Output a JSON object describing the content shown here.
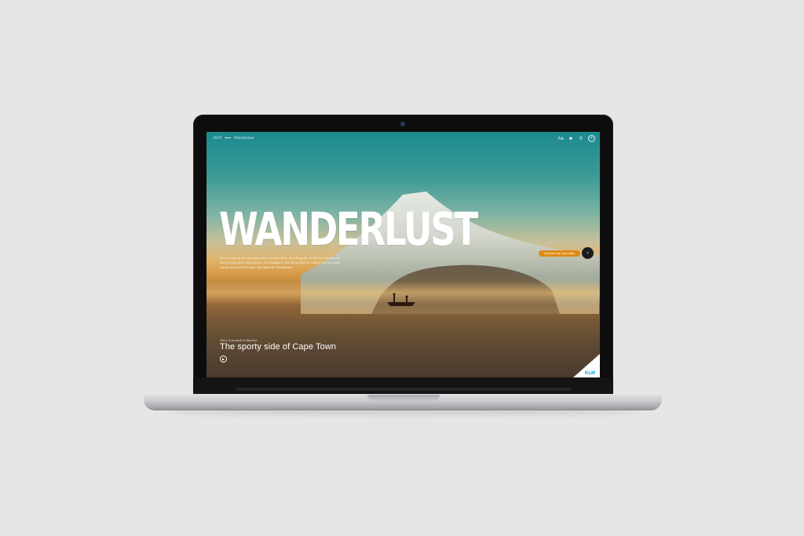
{
  "header": {
    "brand": "1919",
    "section": "Wanderlust"
  },
  "nav_icons": [
    "font-size-icon",
    "user-icon",
    "search-icon",
    "menu-circle-icon"
  ],
  "hero": {
    "headline": "WANDERLUST",
    "intro": "For as long as we can remember, we have been travelling the world and sharing our most memorable experiences. We thought it was about time to collate our favourite stories and put them into one inherent 'Wanderlust'.",
    "cta_label": "Discover our favourites"
  },
  "story": {
    "kicker": "There is so much to discover",
    "title": "The sporty side of Cape Town"
  },
  "logo": {
    "text": "KLM"
  },
  "colors": {
    "accent": "#e08a14",
    "brand_blue": "#00a1de"
  }
}
